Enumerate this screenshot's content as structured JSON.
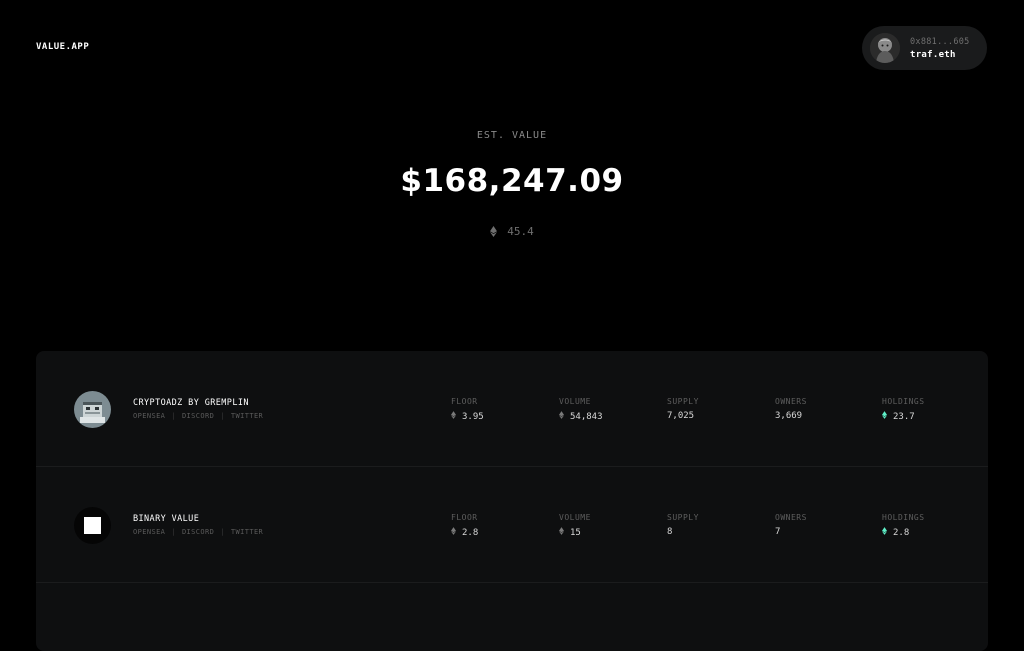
{
  "app": {
    "logo": "VALUE.APP"
  },
  "wallet": {
    "address": "0x881...605",
    "ens": "traf.eth"
  },
  "hero": {
    "label": "EST. VALUE",
    "usd_value": "$168,247.09",
    "eth_value": "45.4"
  },
  "colors": {
    "background": "#000000",
    "panel": "#0e0f10",
    "holdings_accent": "#5ff0c8"
  },
  "collections": [
    {
      "name": "CRYPTOADZ BY GREMPLIN",
      "links": [
        "OPENSEA",
        "DISCORD",
        "TWITTER"
      ],
      "stats": {
        "floor_label": "FLOOR",
        "floor": "3.95",
        "volume_label": "VOLUME",
        "volume": "54,843",
        "supply_label": "SUPPLY",
        "supply": "7,025",
        "owners_label": "OWNERS",
        "owners": "3,669",
        "holdings_label": "HOLDINGS",
        "holdings": "23.7"
      }
    },
    {
      "name": "BINARY VALUE",
      "links": [
        "OPENSEA",
        "DISCORD",
        "TWITTER"
      ],
      "stats": {
        "floor_label": "FLOOR",
        "floor": "2.8",
        "volume_label": "VOLUME",
        "volume": "15",
        "supply_label": "SUPPLY",
        "supply": "8",
        "owners_label": "OWNERS",
        "owners": "7",
        "holdings_label": "HOLDINGS",
        "holdings": "2.8"
      }
    }
  ]
}
